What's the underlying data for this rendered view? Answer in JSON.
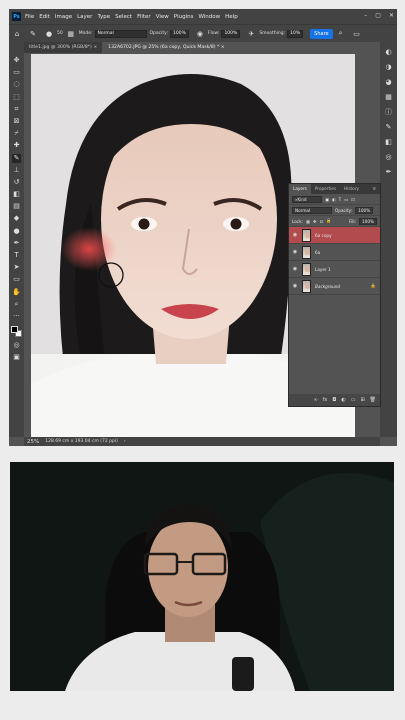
{
  "menu": {
    "app_logo": "Ps",
    "items": [
      "File",
      "Edit",
      "Image",
      "Layer",
      "Type",
      "Select",
      "Filter",
      "View",
      "Plugins",
      "Window",
      "Help"
    ]
  },
  "options_bar": {
    "brush_size": "50",
    "mode_label": "Mode:",
    "mode_value": "Normal",
    "opacity_label": "Opacity:",
    "opacity_value": "100%",
    "flow_label": "Flow:",
    "flow_value": "100%",
    "smoothing_label": "Smoothing:",
    "smoothing_value": "10%",
    "share_label": "Share"
  },
  "tabs": [
    {
      "label": "title1.jpg @ 300% (RGB/8*)",
      "close": "×",
      "active": false
    },
    {
      "label": "132A6702.JPG @ 25% (6a copy, Quick Mask/8) *",
      "close": "×",
      "active": true
    }
  ],
  "status": {
    "zoom": "25%",
    "doc_info": "128.69 cm x 193.04 cm (72 ppi)"
  },
  "layers_panel": {
    "tabs": [
      "Layers",
      "Properties",
      "History"
    ],
    "kind_label": "Kind",
    "blend_mode": "Normal",
    "opacity_label": "Opacity:",
    "opacity_value": "100%",
    "lock_label": "Lock:",
    "fill_label": "Fill:",
    "fill_value": "100%",
    "layers": [
      {
        "name": "6a copy",
        "selected": true
      },
      {
        "name": "6a",
        "selected": false
      },
      {
        "name": "Layer 1",
        "selected": false
      },
      {
        "name": "Background",
        "selected": false,
        "locked": true
      }
    ],
    "footer_icons": [
      "link-icon",
      "fx-icon",
      "mask-icon",
      "adjustment-icon",
      "group-icon",
      "new-layer-icon",
      "trash-icon"
    ]
  },
  "colors": {
    "accent": "#1473e6",
    "selected_layer": "#b24b4e",
    "panel_bg": "#535353",
    "chrome_bg": "#434343"
  }
}
